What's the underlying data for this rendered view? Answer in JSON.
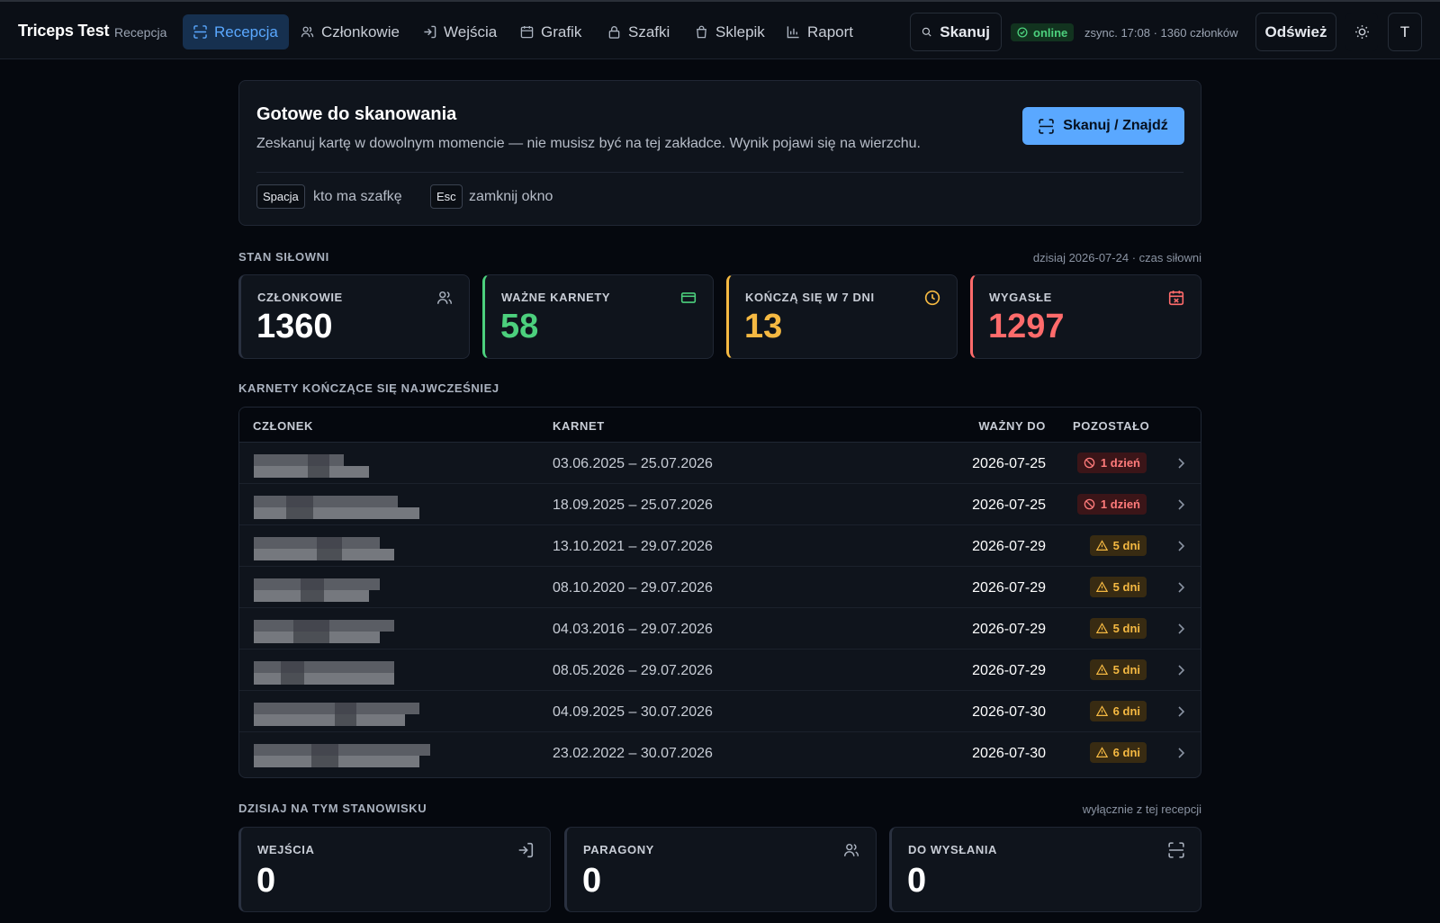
{
  "app": {
    "title": "Triceps Test",
    "subtitle": "Recepcja"
  },
  "nav": {
    "items": [
      {
        "label": "Recepcja",
        "icon": "scan-icon",
        "active": true
      },
      {
        "label": "Członkowie",
        "icon": "users-icon",
        "active": false
      },
      {
        "label": "Wejścia",
        "icon": "login-icon",
        "active": false
      },
      {
        "label": "Grafik",
        "icon": "calendar-icon",
        "active": false
      },
      {
        "label": "Szafki",
        "icon": "lock-icon",
        "active": false
      },
      {
        "label": "Sklepik",
        "icon": "shopping-bag-icon",
        "active": false
      },
      {
        "label": "Raport",
        "icon": "bar-chart-icon",
        "active": false
      }
    ]
  },
  "toolbar": {
    "scan_label": "Skanuj",
    "online_label": "online",
    "sync_text": "zsync. 17:08 · 1360 członków",
    "refresh_label": "Odśwież",
    "theme_icon": "sun-icon",
    "avatar_letter": "T"
  },
  "hero": {
    "title": "Gotowe do skanowania",
    "description": "Zeskanuj kartę w dowolnym momencie — nie musisz być na tej zakładce. Wynik pojawi się na wierzchu.",
    "button_label": "Skanuj / Znajdź",
    "shortcuts": [
      {
        "key": "Spacja",
        "label": "kto ma szafkę"
      },
      {
        "key": "Esc",
        "label": "zamknij okno"
      }
    ]
  },
  "gym_state": {
    "heading": "STAN SIŁOWNI",
    "note": "dzisiaj 2026-07-24 · czas siłowni",
    "stats": [
      {
        "label": "CZŁONKOWIE",
        "value": "1360",
        "icon": "users-icon",
        "color": "#ffffff",
        "accent": "#2a3140"
      },
      {
        "label": "WAŻNE KARNETY",
        "value": "58",
        "icon": "credit-card-icon",
        "color": "#4cd07d",
        "accent": "#4cd07d"
      },
      {
        "label": "KOŃCZĄ SIĘ W 7 DNI",
        "value": "13",
        "icon": "clock-icon",
        "color": "#f5b942",
        "accent": "#f5b942"
      },
      {
        "label": "WYGASŁE",
        "value": "1297",
        "icon": "calendar-x-icon",
        "color": "#ff6b6b",
        "accent": "#ff6b6b"
      }
    ]
  },
  "expiring": {
    "heading": "KARNETY KOŃCZĄCE SIĘ NAJWCZEŚNIEJ",
    "columns": [
      "CZŁONEK",
      "KARNET",
      "WAŻNY DO",
      "POZOSTAŁO"
    ],
    "rows": [
      {
        "member": "",
        "karnet": "03.06.2025 – 25.07.2026",
        "valid_to": "2026-07-25",
        "remaining": "1 dzień",
        "status": "red"
      },
      {
        "member": "",
        "karnet": "18.09.2025 – 25.07.2026",
        "valid_to": "2026-07-25",
        "remaining": "1 dzień",
        "status": "red"
      },
      {
        "member": "",
        "karnet": "13.10.2021 – 29.07.2026",
        "valid_to": "2026-07-29",
        "remaining": "5 dni",
        "status": "amber"
      },
      {
        "member": "",
        "karnet": "08.10.2020 – 29.07.2026",
        "valid_to": "2026-07-29",
        "remaining": "5 dni",
        "status": "amber"
      },
      {
        "member": "",
        "karnet": "04.03.2016 – 29.07.2026",
        "valid_to": "2026-07-29",
        "remaining": "5 dni",
        "status": "amber"
      },
      {
        "member": "",
        "karnet": "08.05.2026 – 29.07.2026",
        "valid_to": "2026-07-29",
        "remaining": "5 dni",
        "status": "amber"
      },
      {
        "member": "",
        "karnet": "04.09.2025 – 30.07.2026",
        "valid_to": "2026-07-30",
        "remaining": "6 dni",
        "status": "amber"
      },
      {
        "member": "",
        "karnet": "23.02.2022 – 30.07.2026",
        "valid_to": "2026-07-30",
        "remaining": "6 dni",
        "status": "amber"
      }
    ]
  },
  "today": {
    "heading": "DZISIAJ NA TYM STANOWISKU",
    "note": "wyłącznie z tej recepcji",
    "stats": [
      {
        "label": "WEJŚCIA",
        "value": "0",
        "icon": "login-icon"
      },
      {
        "label": "PARAGONY",
        "value": "0",
        "icon": "users-icon"
      },
      {
        "label": "DO WYSŁANIA",
        "value": "0",
        "icon": "scan-icon"
      }
    ]
  }
}
